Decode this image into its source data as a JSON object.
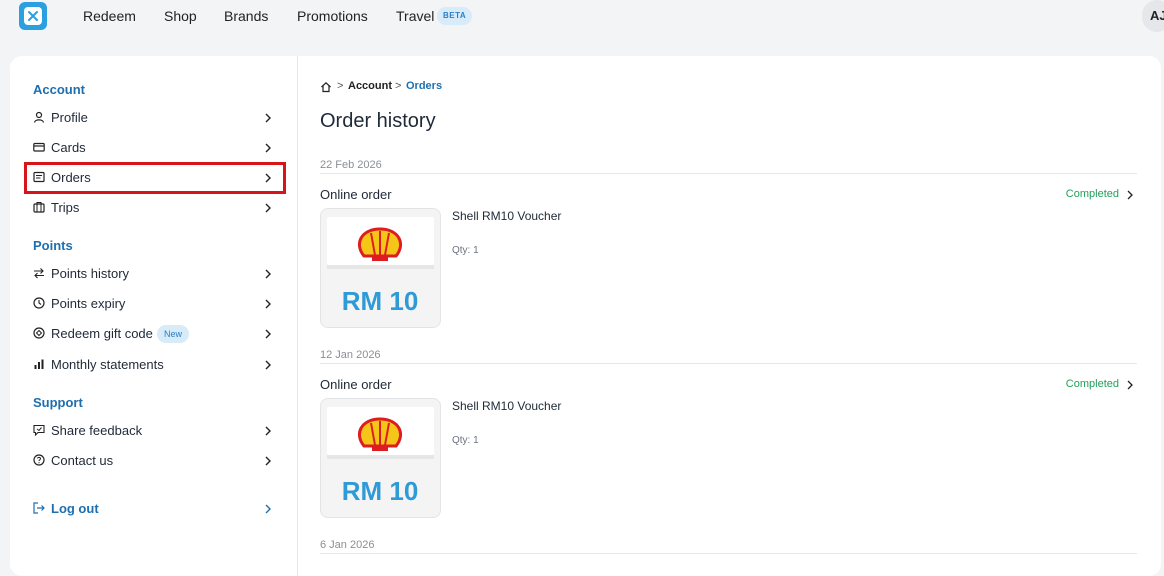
{
  "nav": {
    "items": [
      "Redeem",
      "Shop",
      "Brands",
      "Promotions",
      "Travel"
    ],
    "travel_badge": "BETA",
    "avatar_initials": "AJ"
  },
  "sidebar": {
    "sections": [
      {
        "title": "Account",
        "items": [
          {
            "label": "Profile",
            "icon": "user-icon"
          },
          {
            "label": "Cards",
            "icon": "card-icon"
          },
          {
            "label": "Orders",
            "icon": "receipt-icon",
            "selected": true
          },
          {
            "label": "Trips",
            "icon": "luggage-icon"
          }
        ]
      },
      {
        "title": "Points",
        "items": [
          {
            "label": "Points history",
            "icon": "swap-icon"
          },
          {
            "label": "Points expiry",
            "icon": "clock-icon"
          },
          {
            "label": "Redeem gift code",
            "icon": "gift-icon",
            "badge": "New"
          },
          {
            "label": "Monthly statements",
            "icon": "bar-chart-icon"
          }
        ]
      },
      {
        "title": "Support",
        "items": [
          {
            "label": "Share feedback",
            "icon": "feedback-icon"
          },
          {
            "label": "Contact us",
            "icon": "help-icon"
          }
        ]
      }
    ],
    "logout_label": "Log out"
  },
  "breadcrumb": {
    "sep": ">",
    "account": "Account",
    "current": "Orders"
  },
  "page_title": "Order history",
  "orders": [
    {
      "date": "22 Feb 2026",
      "type": "Online order",
      "status": "Completed",
      "product": "Shell RM10 Voucher",
      "qty": "Qty: 1",
      "voucher_text": "RM 10"
    },
    {
      "date": "12 Jan 2026",
      "type": "Online order",
      "status": "Completed",
      "product": "Shell RM10 Voucher",
      "qty": "Qty: 1",
      "voucher_text": "RM 10"
    },
    {
      "date": "6 Jan 2026"
    }
  ],
  "colors": {
    "accent": "#1e6fb0",
    "success": "#21a05c",
    "highlight": "#d7141a"
  }
}
